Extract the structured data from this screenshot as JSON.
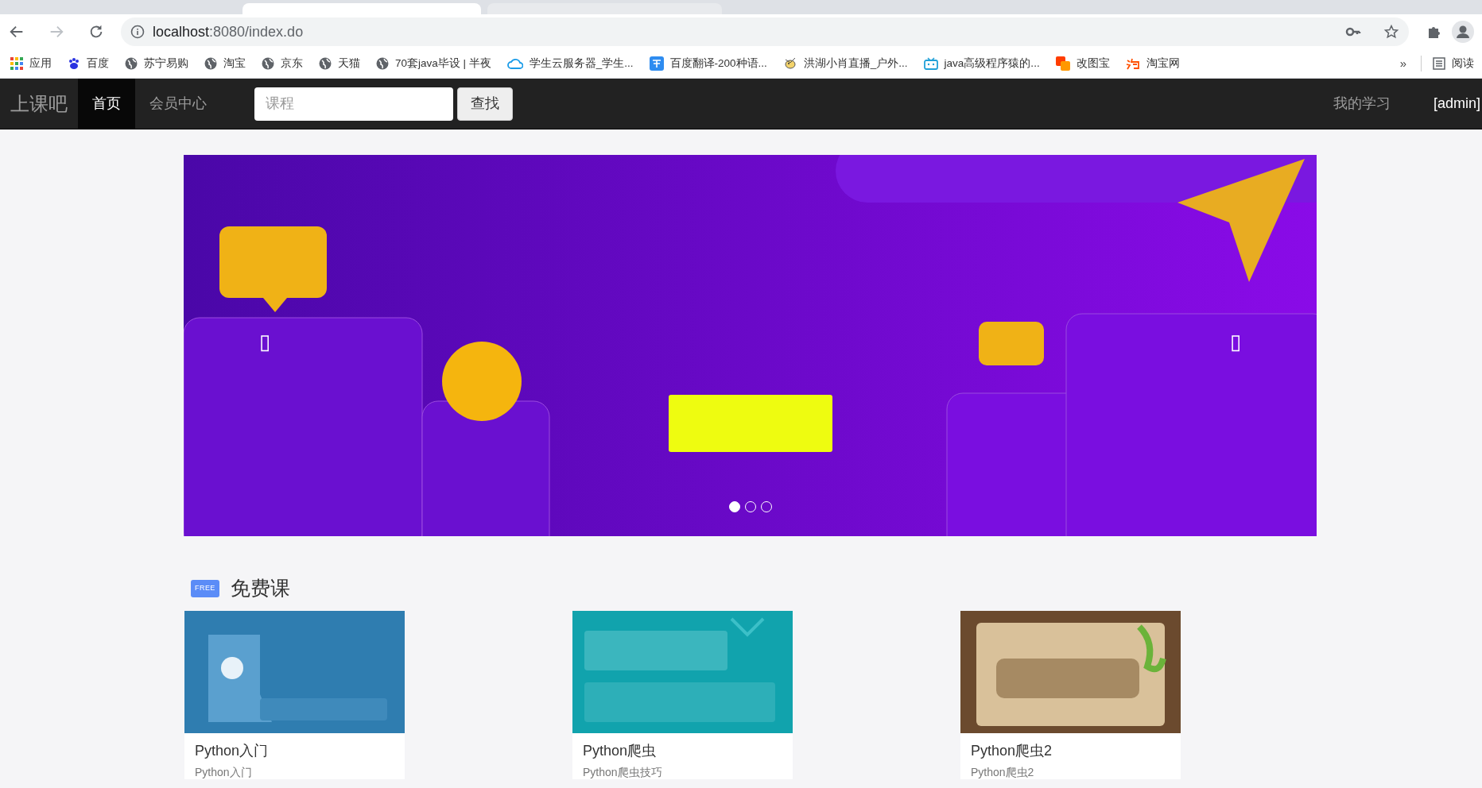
{
  "browser": {
    "url_host": "localhost",
    "url_rest": ":8080/index.do"
  },
  "bookmarks": [
    {
      "label": "应用",
      "kind": "apps"
    },
    {
      "label": "百度",
      "kind": "paw"
    },
    {
      "label": "苏宁易购",
      "kind": "globe"
    },
    {
      "label": "淘宝",
      "kind": "globe"
    },
    {
      "label": "京东",
      "kind": "globe"
    },
    {
      "label": "天猫",
      "kind": "globe"
    },
    {
      "label": "70套java毕设 | 半夜",
      "kind": "globe"
    },
    {
      "label": "学生云服务器_学生...",
      "kind": "cloud"
    },
    {
      "label": "百度翻译-200种语...",
      "kind": "translate"
    },
    {
      "label": "洪湖小肖直播_户外...",
      "kind": "bird"
    },
    {
      "label": "java高级程序猿的...",
      "kind": "tv"
    },
    {
      "label": "改图宝",
      "kind": "squares"
    },
    {
      "label": "淘宝网",
      "kind": "tao"
    }
  ],
  "bookmarks_more": "»",
  "reading_list": "阅读",
  "navbar": {
    "brand": "上课吧",
    "items": [
      {
        "label": "首页",
        "selected": true
      },
      {
        "label": "会员中心",
        "selected": false
      }
    ],
    "search": {
      "placeholder": "课程"
    },
    "search_button": "查找",
    "right_links": [
      "我的学习",
      "[admin]"
    ]
  },
  "carousel": {
    "prev": "▯",
    "next": "▯",
    "dots": [
      {
        "selected": true
      },
      {
        "selected": false
      },
      {
        "selected": false
      }
    ]
  },
  "section": {
    "badge": "FREE",
    "title": "免费课"
  },
  "courses": [
    {
      "title": "Python入门",
      "subtitle": "Python入门"
    },
    {
      "title": "Python爬虫",
      "subtitle": "Python爬虫技巧"
    },
    {
      "title": "Python爬虫2",
      "subtitle": "Python爬虫2"
    }
  ]
}
